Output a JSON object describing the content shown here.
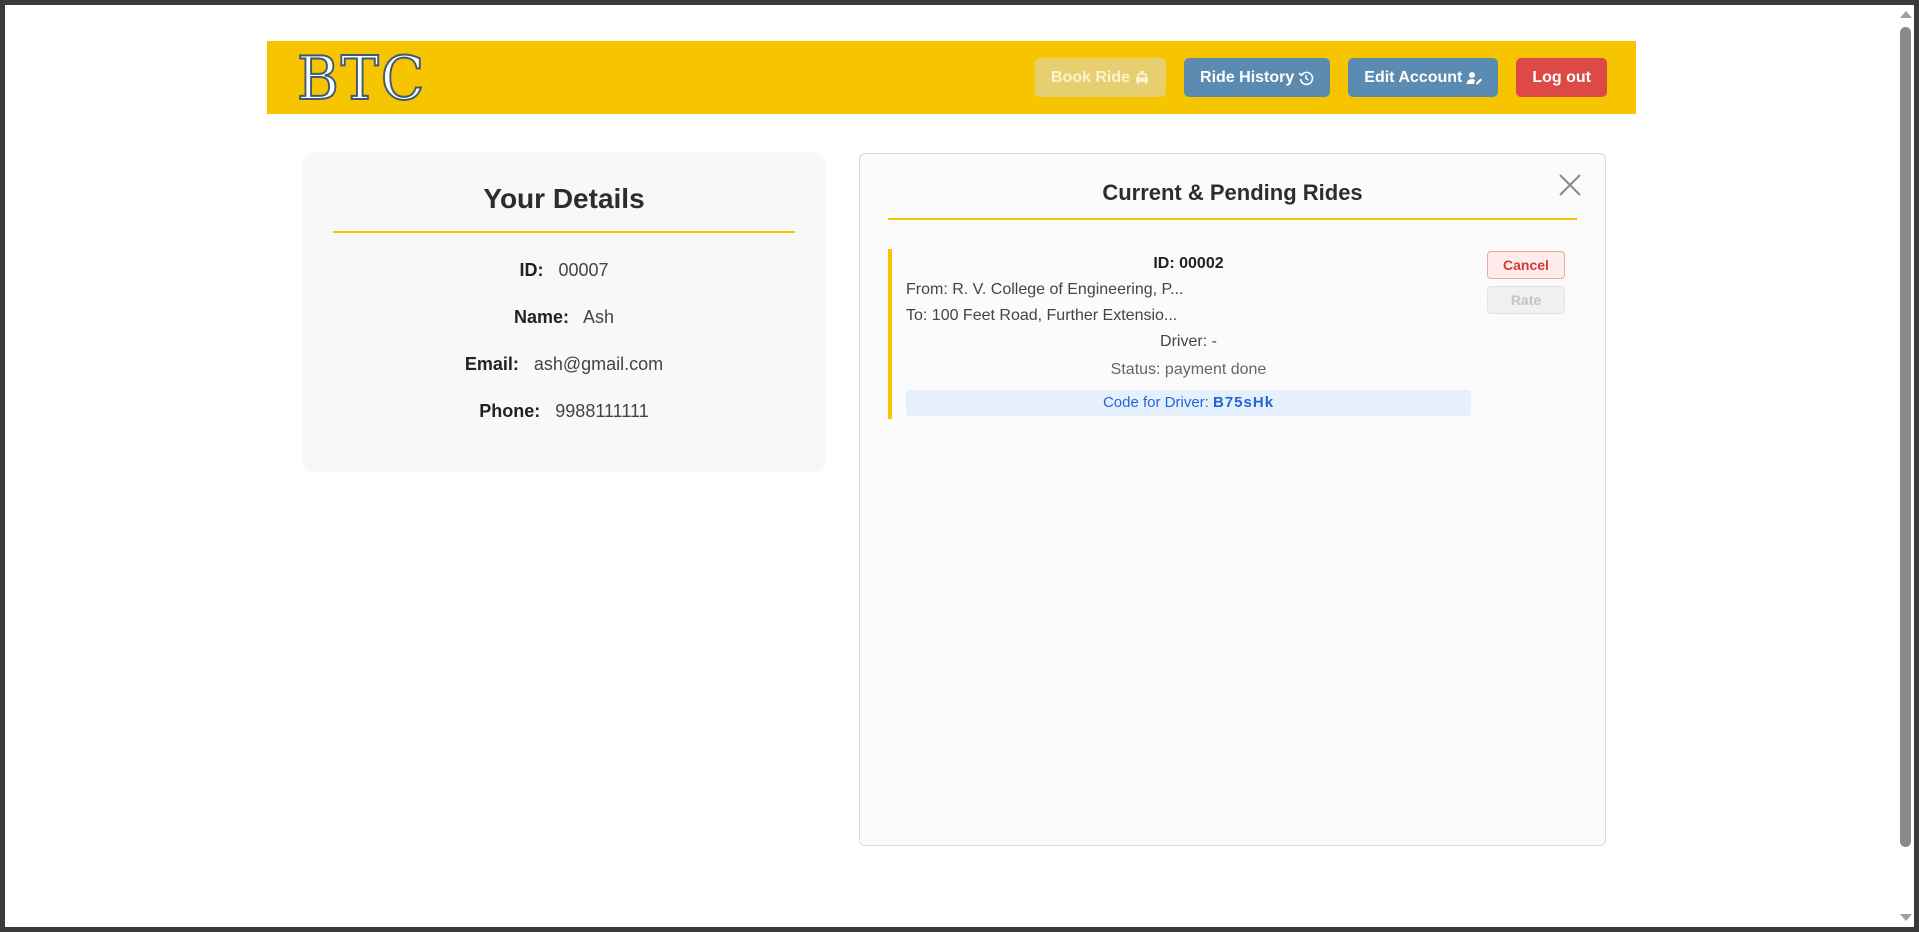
{
  "colors": {
    "brand_yellow": "#f6c500",
    "nav_blue": "#5b8bb1",
    "logout_red": "#dd4a45",
    "code_blue": "#1f66d6"
  },
  "navbar": {
    "logo": "BTC",
    "buttons": {
      "book_ride": "Book Ride",
      "ride_history": "Ride History",
      "edit_account": "Edit Account",
      "logout": "Log out"
    }
  },
  "details": {
    "title": "Your Details",
    "id_label": "ID:",
    "id_value": "00007",
    "name_label": "Name:",
    "name_value": "Ash",
    "email_label": "Email:",
    "email_value": "ash@gmail.com",
    "phone_label": "Phone:",
    "phone_value": "9988111111"
  },
  "rides": {
    "title": "Current & Pending Rides",
    "items": [
      {
        "id": "ID: 00002",
        "from": "From: R. V. College of Engineering, P...",
        "to": "To: 100 Feet Road, Further Extensio...",
        "driver": "Driver: -",
        "status": "Status: payment done",
        "code_label": "Code for Driver:",
        "code_value": "B75sHk",
        "cancel_label": "Cancel",
        "rate_label": "Rate"
      }
    ]
  }
}
